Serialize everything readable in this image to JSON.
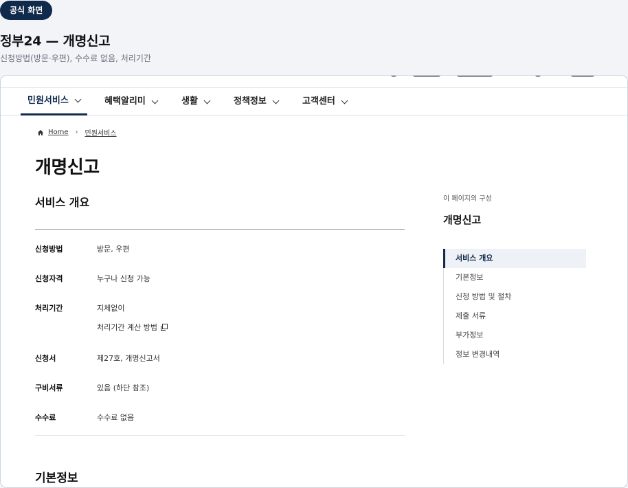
{
  "badge": "공식 화면",
  "heading": "정부24 — 개명신고",
  "subheading": "신청방법(방문·우편), 수수료 없음, 처리기간",
  "nav": {
    "items": [
      {
        "label": "민원서비스"
      },
      {
        "label": "혜택알리미"
      },
      {
        "label": "생활"
      },
      {
        "label": "정책정보"
      },
      {
        "label": "고객센터"
      }
    ],
    "active_index": 0
  },
  "breadcrumb": {
    "home": "Home",
    "current": "민원서비스"
  },
  "page_title": "개명신고",
  "overview": {
    "title": "서비스 개요",
    "rows": [
      {
        "label": "신청방법",
        "value": "방문, 우편"
      },
      {
        "label": "신청자격",
        "value": "누구나 신청 가능"
      },
      {
        "label": "처리기간",
        "value": "지체없이",
        "link": "처리기간 계산 방법"
      },
      {
        "label": "신청서",
        "value": "제27호, 개명신고서"
      },
      {
        "label": "구비서류",
        "value": "있음 (하단 참조)"
      },
      {
        "label": "수수료",
        "value": "수수료 없음"
      }
    ]
  },
  "next_section_title": "기본정보",
  "toc": {
    "caption": "이 페이지의 구성",
    "title": "개명신고",
    "items": [
      "서비스 개요",
      "기본정보",
      "신청 방법 및 절차",
      "제출 서류",
      "부가정보",
      "정보 변경내역"
    ],
    "active_index": 0
  },
  "colors": {
    "accent": "#102a4c",
    "badge_bg": "#102a4c",
    "active_bg": "#eef1f5"
  }
}
